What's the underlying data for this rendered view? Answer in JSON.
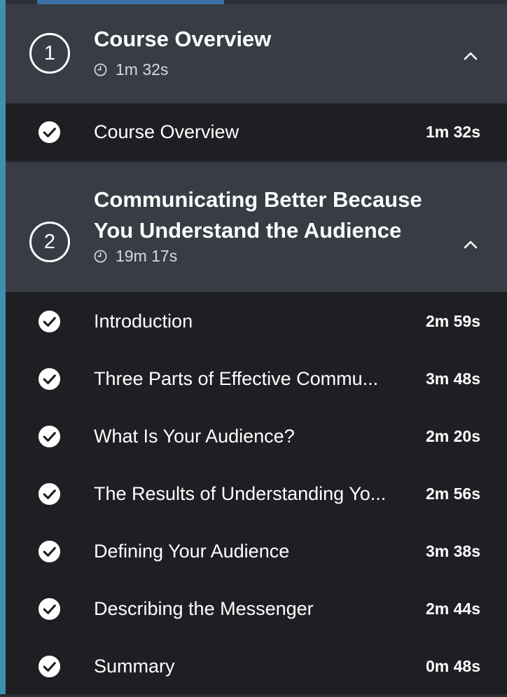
{
  "progress": {
    "fraction": 0.37
  },
  "colors": {
    "accent": "#3f8fae",
    "progress": "#3c6fa8",
    "header_bg": "#383d45",
    "list_bg": "#1d1f23"
  },
  "modules": [
    {
      "number": "1",
      "title": "Course Overview",
      "duration": "1m 32s",
      "expanded": true,
      "clips": [
        {
          "title": "Course Overview",
          "duration": "1m 32s",
          "completed": true
        }
      ]
    },
    {
      "number": "2",
      "title": "Communicating Better Because You Understand the Audience",
      "duration": "19m 17s",
      "expanded": true,
      "clips": [
        {
          "title": "Introduction",
          "duration": "2m 59s",
          "completed": true
        },
        {
          "title": "Three Parts of Effective Commu...",
          "duration": "3m 48s",
          "completed": true
        },
        {
          "title": "What Is Your Audience?",
          "duration": "2m 20s",
          "completed": true
        },
        {
          "title": "The Results of Understanding Yo...",
          "duration": "2m 56s",
          "completed": true
        },
        {
          "title": "Defining Your Audience",
          "duration": "3m 38s",
          "completed": true
        },
        {
          "title": "Describing the Messenger",
          "duration": "2m 44s",
          "completed": true
        },
        {
          "title": "Summary",
          "duration": "0m 48s",
          "completed": true
        }
      ]
    }
  ],
  "icons": {
    "clock": "clock-icon",
    "check": "check-circle-icon",
    "collapse": "chevron-up-icon"
  }
}
